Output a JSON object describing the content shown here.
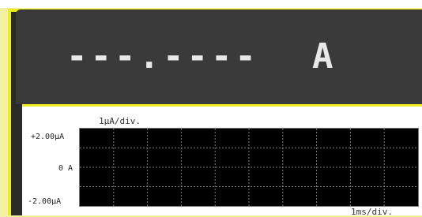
{
  "top_strip_text": "",
  "readout": {
    "value": "---.----",
    "unit": "A"
  },
  "chart": {
    "x_scale_label": "1ms/div.",
    "y_scale_label": "1µA/div.",
    "y_labels": {
      "top": "+2.00µA",
      "mid": "0 A",
      "bottom": "-2.00µA"
    }
  },
  "colors": {
    "frame_accent": "#ecec1f",
    "panel_bg": "#2a2a2a",
    "plot_bg": "#000000",
    "grid": "#7a7a7a"
  }
}
